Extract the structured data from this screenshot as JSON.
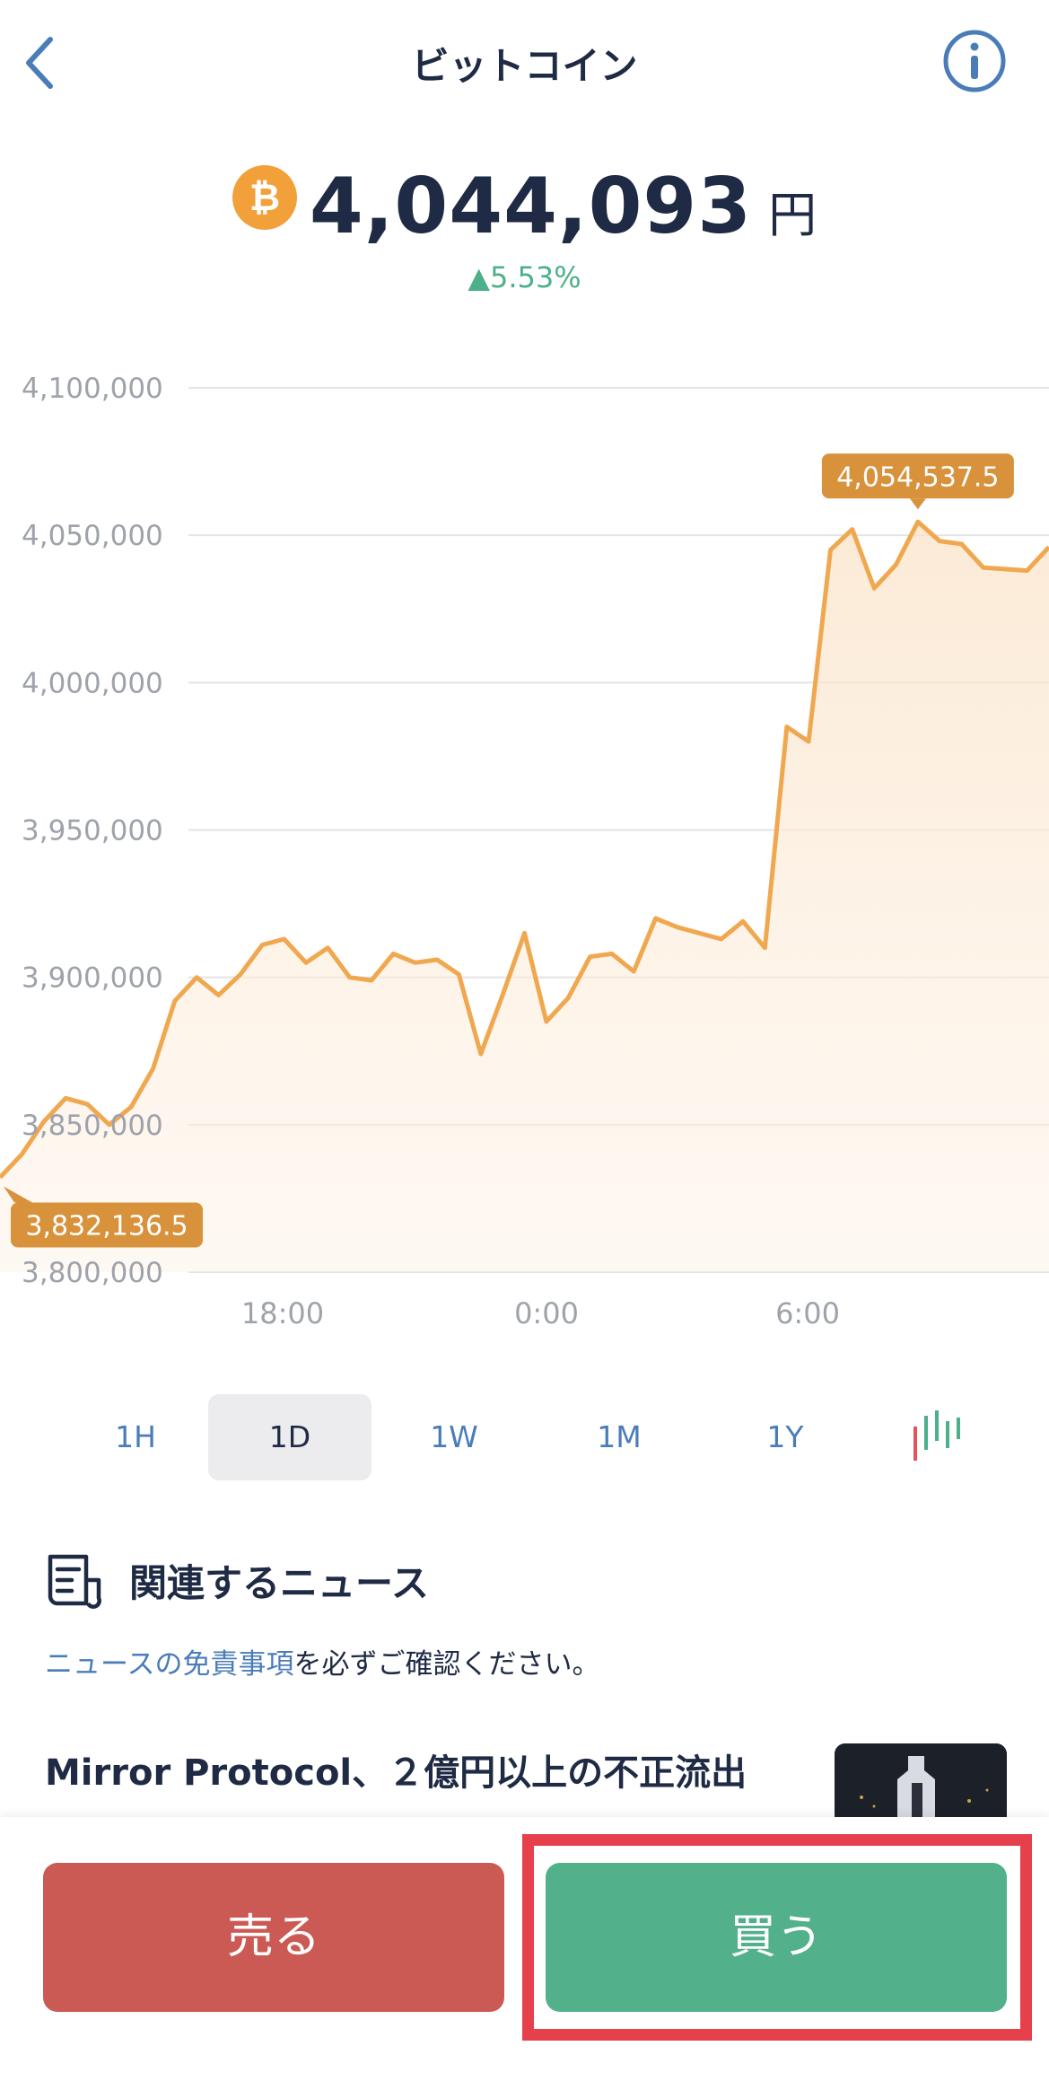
{
  "header": {
    "title": "ビットコイン",
    "back_icon": "chevron-left-icon",
    "info_icon": "info-circle-icon"
  },
  "price": {
    "coin_icon": "bitcoin-icon",
    "value": "4,044,093",
    "unit": "円",
    "change": "▲5.53%"
  },
  "colors": {
    "accent_blue": "#4a7db8",
    "line_orange": "#f0a850",
    "callout_orange": "#d9923c",
    "up_green": "#4cb08a",
    "sell_red": "#cb5a55",
    "buy_green": "#52b08a",
    "highlight_red": "#e5404b"
  },
  "chart_data": {
    "type": "area",
    "y_ticks": [
      "4,100,000",
      "4,050,000",
      "4,000,000",
      "3,950,000",
      "3,900,000",
      "3,850,000",
      "3,800,000"
    ],
    "x_ticks": [
      "18:00",
      "0:00",
      "6:00"
    ],
    "ylim": [
      3800000,
      4100000
    ],
    "high_label": "4,054,537.5",
    "low_label": "3,832,136.5",
    "series": [
      {
        "values": [
          3832137,
          3840000,
          3851000,
          3859000,
          3857000,
          3850000,
          3856000,
          3869000,
          3892000,
          3900000,
          3894000,
          3901000,
          3911000,
          3913000,
          3905000,
          3910000,
          3900000,
          3899000,
          3908000,
          3905000,
          3906000,
          3901000,
          3874000,
          3894000,
          3915000,
          3885000,
          3893000,
          3907000,
          3908000,
          3902000,
          3920000,
          3917000,
          3915000,
          3913000,
          3919000,
          3910000,
          3985000,
          3980000,
          4045000,
          4052000,
          4032000,
          4040000,
          4054538,
          4048000,
          4047000,
          4039000,
          4038500,
          4038000,
          4046000
        ]
      }
    ],
    "grid": true,
    "legend": "none"
  },
  "ranges": {
    "items": [
      "1H",
      "1D",
      "1W",
      "1M",
      "1Y"
    ],
    "selected": "1D",
    "candle_icon": "candlestick-icon"
  },
  "news": {
    "icon": "newspaper-icon",
    "heading": "関連するニュース",
    "disclaimer_link": "ニュースの免責事項",
    "disclaimer_text": "を必ずご確認ください。",
    "article_title": "Mirror Protocol、２億円以上の不正流出"
  },
  "actions": {
    "sell": "売る",
    "buy": "買う"
  }
}
